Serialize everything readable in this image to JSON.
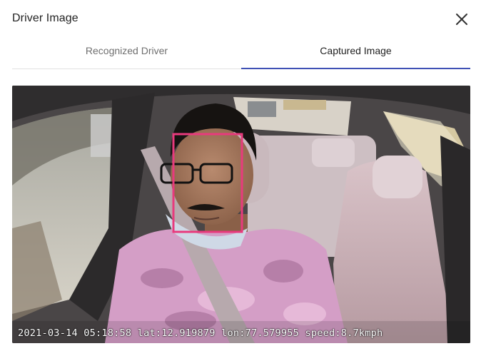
{
  "dialog": {
    "title": "Driver Image"
  },
  "tabs": [
    {
      "label": "Recognized Driver",
      "active": false
    },
    {
      "label": "Captured Image",
      "active": true
    }
  ],
  "capture": {
    "overlay_text": "2021-03-14 05:18:58 lat:12.919879 lon:77.579955 speed:8.7kmph",
    "face_box_color": "#e83a7d"
  },
  "icons": {
    "close": "close-icon"
  },
  "colors": {
    "accent": "#3f51b5",
    "active_tab_text": "#1f1f1f",
    "inactive_tab_text": "#6f6f6f"
  }
}
